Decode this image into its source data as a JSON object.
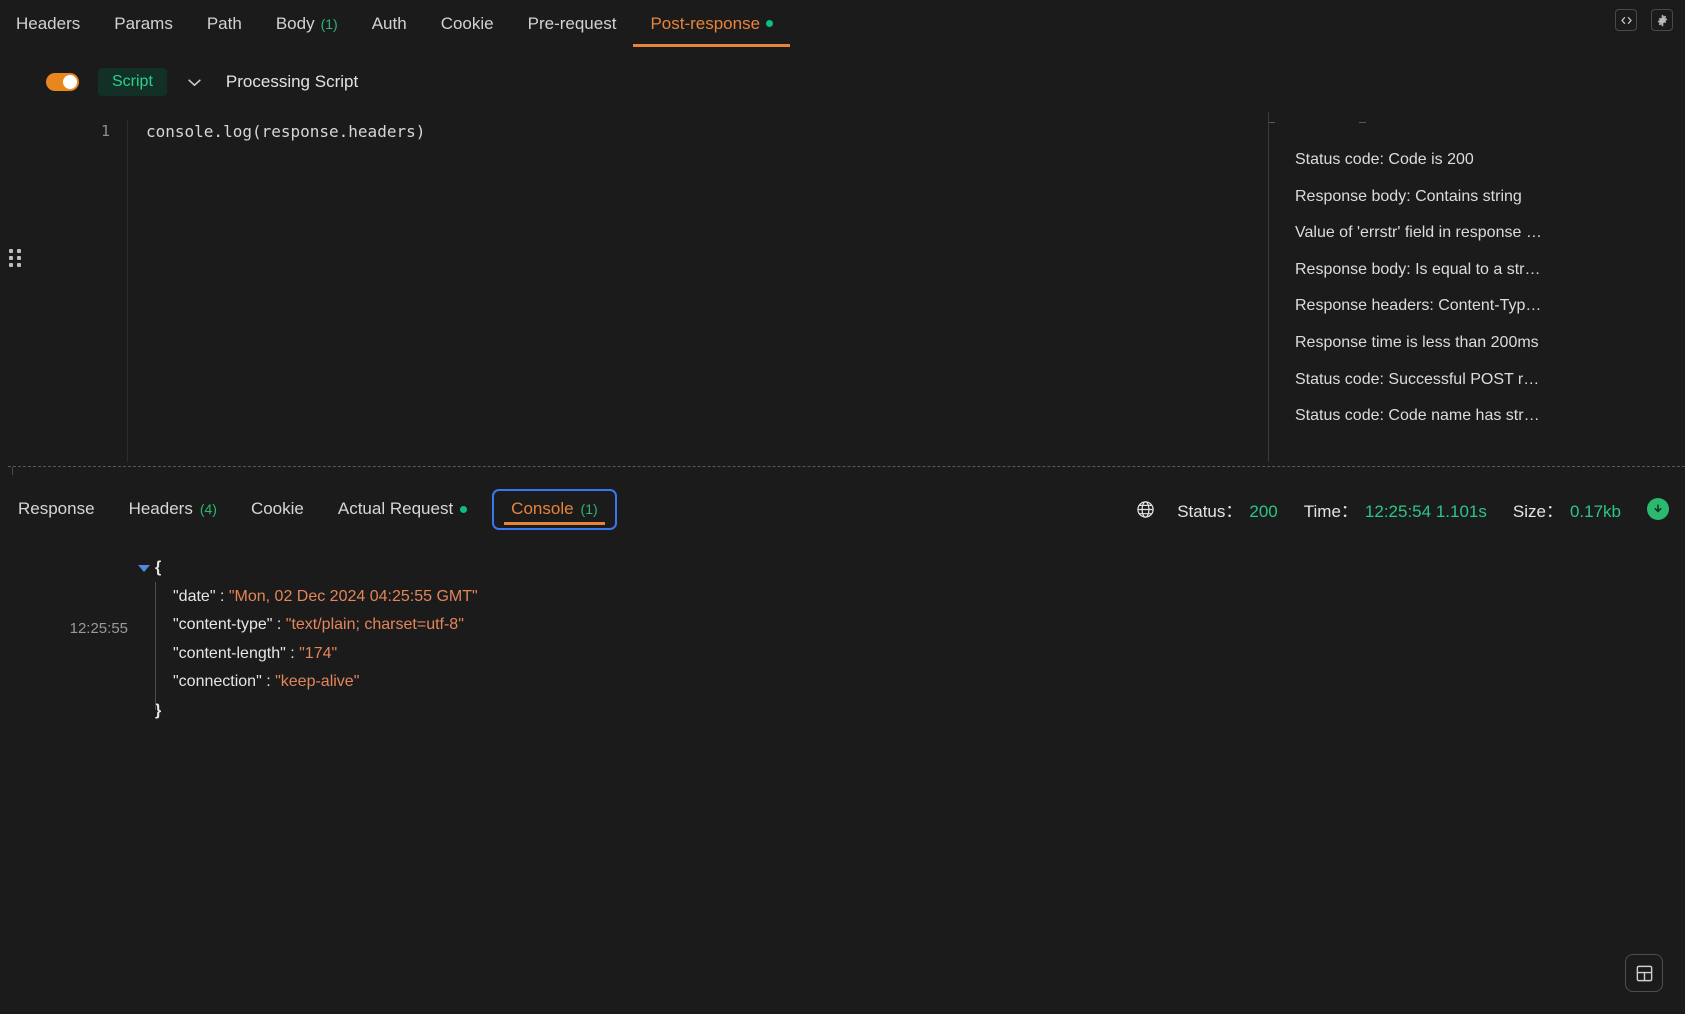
{
  "top_tabs": [
    {
      "label": "Headers",
      "count": null,
      "active": false,
      "dot": false
    },
    {
      "label": "Params",
      "count": null,
      "active": false,
      "dot": false
    },
    {
      "label": "Path",
      "count": null,
      "active": false,
      "dot": false
    },
    {
      "label": "Body",
      "count": "(1)",
      "active": false,
      "dot": false
    },
    {
      "label": "Auth",
      "count": null,
      "active": false,
      "dot": false
    },
    {
      "label": "Cookie",
      "count": null,
      "active": false,
      "dot": false
    },
    {
      "label": "Pre-request",
      "count": null,
      "active": false,
      "dot": false
    },
    {
      "label": "Post-response",
      "count": null,
      "active": true,
      "dot": true
    }
  ],
  "top_icons": {
    "code_icon": "</>",
    "settings_icon": "gear"
  },
  "script_bar": {
    "toggle_on": true,
    "badge_label": "Script",
    "caret": "⌄",
    "title": "Processing Script"
  },
  "editor": {
    "line_number": "1",
    "code": "console.log(response.headers)"
  },
  "snippets": [
    {
      "label": "Status code: Code is 200"
    },
    {
      "label": "Response body: Contains string"
    },
    {
      "label": "Value of 'errstr' field in response JSON"
    },
    {
      "label": "Response body: Is equal to a string"
    },
    {
      "label": "Response headers: Content-Type header check"
    },
    {
      "label": "Response time is less than 200ms"
    },
    {
      "label": "Status code: Successful POST request"
    },
    {
      "label": "Status code: Code name has string"
    }
  ],
  "response_tabs": [
    {
      "label": "Response",
      "count": null,
      "active": false,
      "dot": false,
      "focused": false
    },
    {
      "label": "Headers",
      "count": "(4)",
      "active": false,
      "dot": false,
      "focused": false
    },
    {
      "label": "Cookie",
      "count": null,
      "active": false,
      "dot": false,
      "focused": false
    },
    {
      "label": "Actual Request",
      "count": null,
      "active": false,
      "dot": true,
      "focused": false
    },
    {
      "label": "Console",
      "count": "(1)",
      "active": true,
      "dot": false,
      "focused": true
    }
  ],
  "meta": {
    "globe_icon": "globe",
    "status_label": "Status：",
    "status_value": "200",
    "time_label": "Time：",
    "time_value": "12:25:54 1.101s",
    "size_label": "Size：",
    "size_value": "0.17kb",
    "download_icon": "download"
  },
  "console": {
    "timestamp": "12:25:55",
    "open_brace": "{",
    "close_brace": "}",
    "entries": [
      {
        "key": "\"date\"",
        "colon": " : ",
        "value": "\"Mon, 02 Dec 2024 04:25:55 GMT\""
      },
      {
        "key": "\"content-type\"",
        "colon": " : ",
        "value": "\"text/plain; charset=utf-8\""
      },
      {
        "key": "\"content-length\"",
        "colon": " : ",
        "value": "\"174\""
      },
      {
        "key": "\"connection\"",
        "colon": " : ",
        "value": "\"keep-alive\""
      }
    ]
  },
  "layout_button": {
    "icon": "layout-panels"
  },
  "colors": {
    "background": "#1b1b1b",
    "accent_orange": "#e8833a",
    "accent_green": "#2bb673",
    "focus_blue": "#3a76f0",
    "value_orange": "#e4855a"
  }
}
